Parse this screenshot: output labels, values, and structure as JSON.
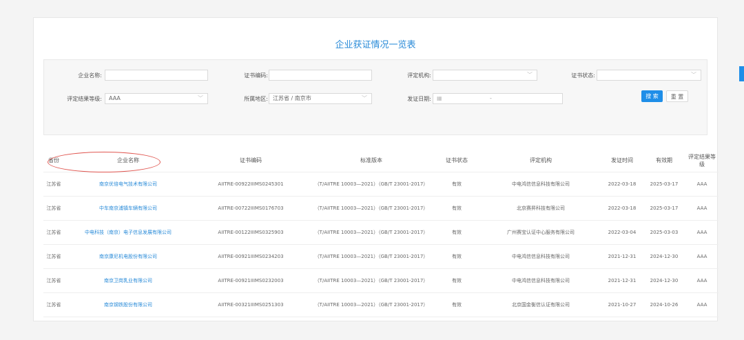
{
  "title": "企业获证情况一览表",
  "filters": {
    "company_label": "企业名称:",
    "cert_no_label": "证书编码:",
    "org_label": "评定机构:",
    "status_label": "证书状态:",
    "grade_label": "评定结果等级:",
    "grade_value": "AAA",
    "region_label": "所属地区:",
    "region_value": "江苏省 / 南京市",
    "date_label": "发证日期:",
    "date_sep": "-"
  },
  "buttons": {
    "search": "搜 索",
    "reset": "重 置"
  },
  "table": {
    "headers": [
      "省份",
      "企业名称",
      "证书编码",
      "标准版本",
      "证书状态",
      "评定机构",
      "发证时间",
      "有效期",
      "评定结果等级"
    ],
    "rows": [
      [
        "江苏省",
        "南京优倍电气技术有限公司",
        "AIITRE-00922IIIMS0245301",
        "（T/AIITRE 10003—2021）（GB/T 23001-2017）",
        "有效",
        "中电鸿信信息科技有限公司",
        "2022-03-18",
        "2025-03-17",
        "AAA"
      ],
      [
        "江苏省",
        "中车南京浦镇车辆有限公司",
        "AIITRE-00722IIIMS0176703",
        "（T/AIITRE 10003—2021）（GB/T 23001-2017）",
        "有效",
        "北京赛昇科技有限公司",
        "2022-03-18",
        "2025-03-17",
        "AAA"
      ],
      [
        "江苏省",
        "中电科技（南京）电子信息发展有限公司",
        "AIITRE-00122IIIMS0325903",
        "（T/AIITRE 10003—2021）（GB/T 23001-2017）",
        "有效",
        "广州赛宝认证中心服务有限公司",
        "2022-03-04",
        "2025-03-03",
        "AAA"
      ],
      [
        "江苏省",
        "南京康尼机电股份有限公司",
        "AIITRE-00921IIIMS0234203",
        "（T/AIITRE 10003—2021）（GB/T 23001-2017）",
        "有效",
        "中电鸿信信息科技有限公司",
        "2021-12-31",
        "2024-12-30",
        "AAA"
      ],
      [
        "江苏省",
        "南京卫岗乳业有限公司",
        "AIITRE-00921IIIMS0232003",
        "（T/AIITRE 10003—2021）（GB/T 23001-2017）",
        "有效",
        "中电鸿信信息科技有限公司",
        "2021-12-31",
        "2024-12-30",
        "AAA"
      ],
      [
        "江苏省",
        "南京钢铁股份有限公司",
        "AIITRE-00321IIIMS0251303",
        "（T/AIITRE 10003—2021）（GB/T 23001-2017）",
        "有效",
        "北京国金衡信认证有限公司",
        "2021-10-27",
        "2024-10-26",
        "AAA"
      ]
    ]
  },
  "colors": {
    "accent": "#1f8ee8",
    "link": "#2a8bd8",
    "highlight": "#e0554f"
  }
}
